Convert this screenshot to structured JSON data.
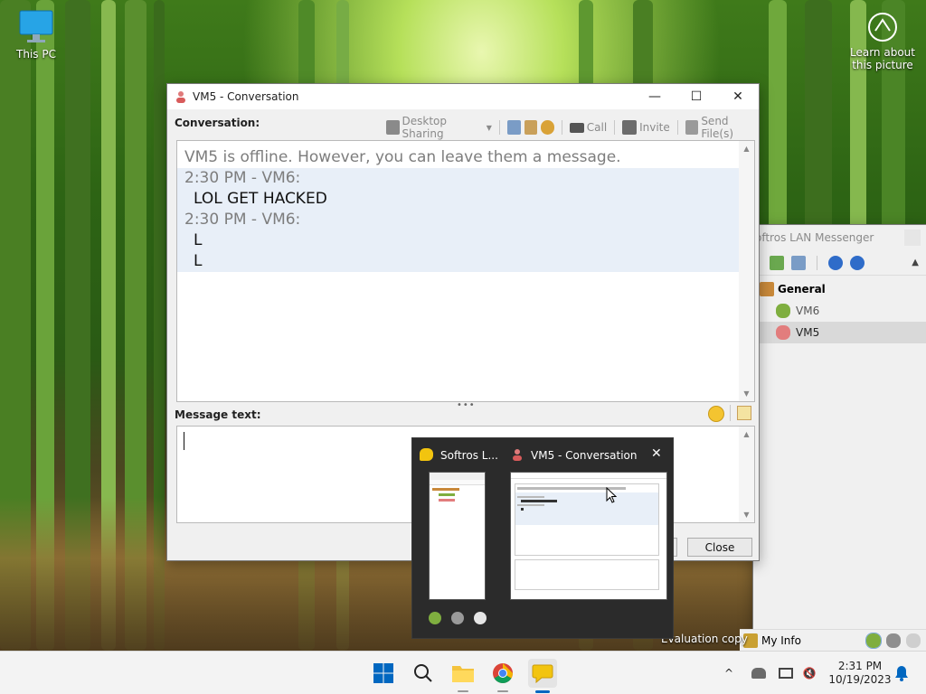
{
  "desktop": {
    "this_pc_label": "This PC",
    "learn_label_line1": "Learn about",
    "learn_label_line2": "this picture",
    "evaluation_text": "Evaluation copy"
  },
  "conversation_window": {
    "title": "VM5 - Conversation",
    "conversation_label": "Conversation:",
    "toolbar": {
      "desktop_sharing": "Desktop Sharing",
      "call": "Call",
      "invite": "Invite",
      "send_files": "Send File(s)"
    },
    "messages": [
      {
        "text": "VM5 is offline. However, you can leave them a message.",
        "style": "gray",
        "highlight": false
      },
      {
        "text": "2:30 PM - VM6:",
        "style": "gray",
        "highlight": true
      },
      {
        "text": "LOL GET HACKED",
        "style": "dark",
        "highlight": true,
        "indent": true
      },
      {
        "text": "2:30 PM - VM6:",
        "style": "gray",
        "highlight": true
      },
      {
        "text": "L",
        "style": "dark",
        "highlight": true,
        "indent": true
      },
      {
        "text": "L",
        "style": "dark",
        "highlight": true,
        "indent": true
      }
    ],
    "message_label": "Message text:",
    "message_value": "",
    "close_button": "Close"
  },
  "messenger_window": {
    "title": "oftros LAN Messenger",
    "group": "General",
    "users": [
      {
        "name": "VM6",
        "status": "online"
      },
      {
        "name": "VM5",
        "status": "offline"
      }
    ],
    "my_info_label": "My Info"
  },
  "thumbnails": {
    "item1_title": "Softros L...",
    "item2_title": "VM5 - Conversation"
  },
  "taskbar": {
    "time": "2:31 PM",
    "date": "10/19/2023"
  },
  "colors": {
    "accent": "#0067c0",
    "highlight_row": "#e8eff8",
    "selected_user": "#d9d9d9"
  }
}
